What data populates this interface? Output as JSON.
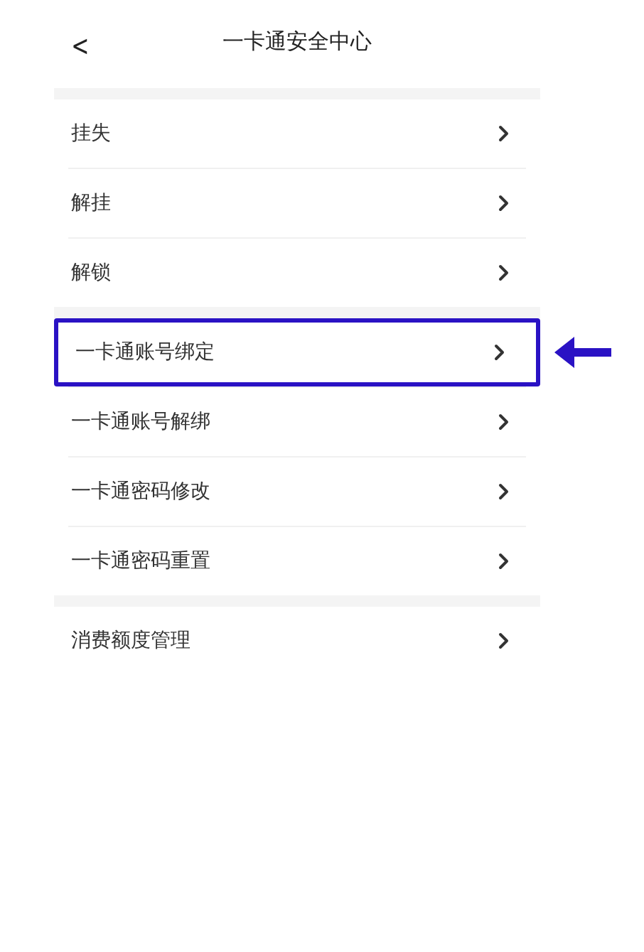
{
  "header": {
    "back": "<",
    "title": "一卡通安全中心"
  },
  "sections": [
    {
      "items": [
        {
          "label": "挂失",
          "highlighted": false
        },
        {
          "label": "解挂",
          "highlighted": false
        },
        {
          "label": "解锁",
          "highlighted": false
        }
      ]
    },
    {
      "items": [
        {
          "label": "一卡通账号绑定",
          "highlighted": true
        },
        {
          "label": "一卡通账号解绑",
          "highlighted": false
        },
        {
          "label": "一卡通密码修改",
          "highlighted": false
        },
        {
          "label": "一卡通密码重置",
          "highlighted": false
        }
      ]
    },
    {
      "items": [
        {
          "label": "消费额度管理",
          "highlighted": false
        }
      ]
    }
  ]
}
